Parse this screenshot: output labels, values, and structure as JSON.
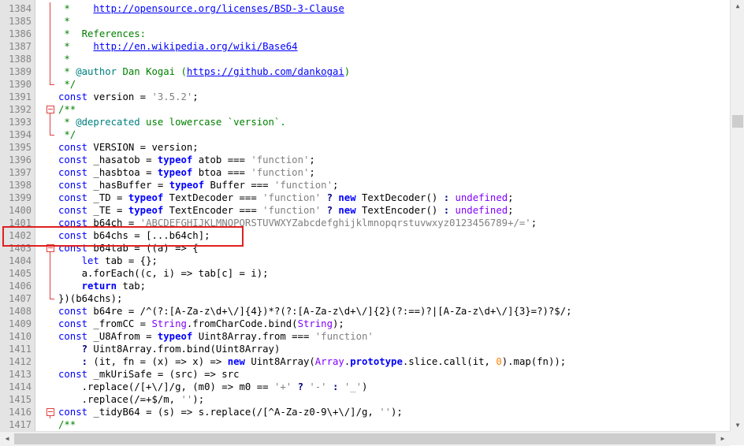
{
  "editor": {
    "lines": [
      {
        "n": "1384",
        "html": "<span class=\"cmt\"> *    </span><span class=\"url\">http://opensource.org/licenses/BSD-3-Clause</span>"
      },
      {
        "n": "1385",
        "html": "<span class=\"cmt\"> *</span>"
      },
      {
        "n": "1386",
        "html": "<span class=\"cmt\"> *  References:</span>"
      },
      {
        "n": "1387",
        "html": "<span class=\"cmt\"> *    </span><span class=\"url\">http://en.wikipedia.org/wiki/Base64</span>"
      },
      {
        "n": "1388",
        "html": "<span class=\"cmt\"> *</span>"
      },
      {
        "n": "1389",
        "html": "<span class=\"cmt\"> * </span><span class=\"doc\">@author</span><span class=\"cmt\"> Dan Kogai (</span><span class=\"url\">https://github.com/dankogai</span><span class=\"cmt\">)</span>"
      },
      {
        "n": "1390",
        "html": "<span class=\"cmt\"> */</span>"
      },
      {
        "n": "1391",
        "html": "<span class=\"kwp\">const</span> version = <span class=\"str\">'3.5.2'</span>;"
      },
      {
        "n": "1392",
        "html": "<span class=\"cmt\">/**</span>"
      },
      {
        "n": "1393",
        "html": "<span class=\"cmt\"> * </span><span class=\"doc\">@deprecated</span><span class=\"cmt\"> use lowercase `version`.</span>"
      },
      {
        "n": "1394",
        "html": "<span class=\"cmt\"> */</span>"
      },
      {
        "n": "1395",
        "html": "<span class=\"kwp\">const</span> VERSION = version;"
      },
      {
        "n": "1396",
        "html": "<span class=\"kwp\">const</span> _hasatob = <span class=\"kw\">typeof</span> atob === <span class=\"str\">'function'</span>;"
      },
      {
        "n": "1397",
        "html": "<span class=\"kwp\">const</span> _hasbtoa = <span class=\"kw\">typeof</span> btoa === <span class=\"str\">'function'</span>;"
      },
      {
        "n": "1398",
        "html": "<span class=\"kwp\">const</span> _hasBuffer = <span class=\"kw\">typeof</span> Buffer === <span class=\"str\">'function'</span>;"
      },
      {
        "n": "1399",
        "html": "<span class=\"kwp\">const</span> _TD = <span class=\"kw\">typeof</span> TextDecoder === <span class=\"str\">'function'</span> <span class=\"op\">?</span> <span class=\"kw\">new</span> TextDecoder() <span class=\"op\">:</span> <span class=\"glob\">undefined</span>;"
      },
      {
        "n": "1400",
        "html": "<span class=\"kwp\">const</span> _TE = <span class=\"kw\">typeof</span> TextEncoder === <span class=\"str\">'function'</span> <span class=\"op\">?</span> <span class=\"kw\">new</span> TextEncoder() <span class=\"op\">:</span> <span class=\"glob\">undefined</span>;"
      },
      {
        "n": "1401",
        "html": "<span class=\"kwp\">const</span> b64ch = <span class=\"str\">'ABCDEFGHIJKLMNOPQRSTUVWXYZabcdefghijklmnopqrstuvwxyz0123456789+/='</span>;"
      },
      {
        "n": "1402",
        "html": "<span class=\"kwp\">const</span> b64chs = [...b64ch];"
      },
      {
        "n": "1403",
        "html": "<span class=\"kwp\">const</span> b64tab = ((a) => {"
      },
      {
        "n": "1404",
        "html": "    <span class=\"kwp\">let</span> tab = {};"
      },
      {
        "n": "1405",
        "html": "    a.forEach((c, i) => tab[c] = i);"
      },
      {
        "n": "1406",
        "html": "    <span class=\"kw\">return</span> tab;"
      },
      {
        "n": "1407",
        "html": "})(b64chs);"
      },
      {
        "n": "1408",
        "html": "<span class=\"kwp\">const</span> b64re = /^(?:[A-Za-z\\d+\\/]{4})*?(?:[A-Za-z\\d+\\/]{2}(?:==)?|[A-Za-z\\d+\\/]{3}=?)?$/;"
      },
      {
        "n": "1409",
        "html": "<span class=\"kwp\">const</span> _fromCC = <span class=\"glob\">String</span>.fromCharCode.bind(<span class=\"glob\">String</span>);"
      },
      {
        "n": "1410",
        "html": "<span class=\"kwp\">const</span> _U8Afrom = <span class=\"kw\">typeof</span> Uint8Array.from === <span class=\"str\">'function'</span>"
      },
      {
        "n": "1411",
        "html": "    <span class=\"op\">?</span> Uint8Array.from.bind(Uint8Array)"
      },
      {
        "n": "1412",
        "html": "    <span class=\"op\">:</span> (it, fn = (x) => x) => <span class=\"kw\">new</span> Uint8Array(<span class=\"glob\">Array</span>.<span class=\"kw\">prototype</span>.slice.call(it, <span class=\"num\">0</span>).map(fn));"
      },
      {
        "n": "1413",
        "html": "<span class=\"kwp\">const</span> _mkUriSafe = (src) => src"
      },
      {
        "n": "1414",
        "html": "    .replace(/[+\\/]/g, (m0) => m0 == <span class=\"str\">'+'</span> <span class=\"op\">?</span> <span class=\"str\">'-'</span> <span class=\"op\">:</span> <span class=\"str\">'_'</span>)"
      },
      {
        "n": "1415",
        "html": "    .replace(/=+$/m, <span class=\"str\">''</span>);"
      },
      {
        "n": "1416",
        "html": "<span class=\"kwp\">const</span> _tidyB64 = (s) => s.replace(/[^A-Za-z0-9\\+\\/]/g, <span class=\"str\">''</span>);"
      },
      {
        "n": "1417",
        "html": "<span class=\"cmt\">/**</span>"
      }
    ]
  }
}
